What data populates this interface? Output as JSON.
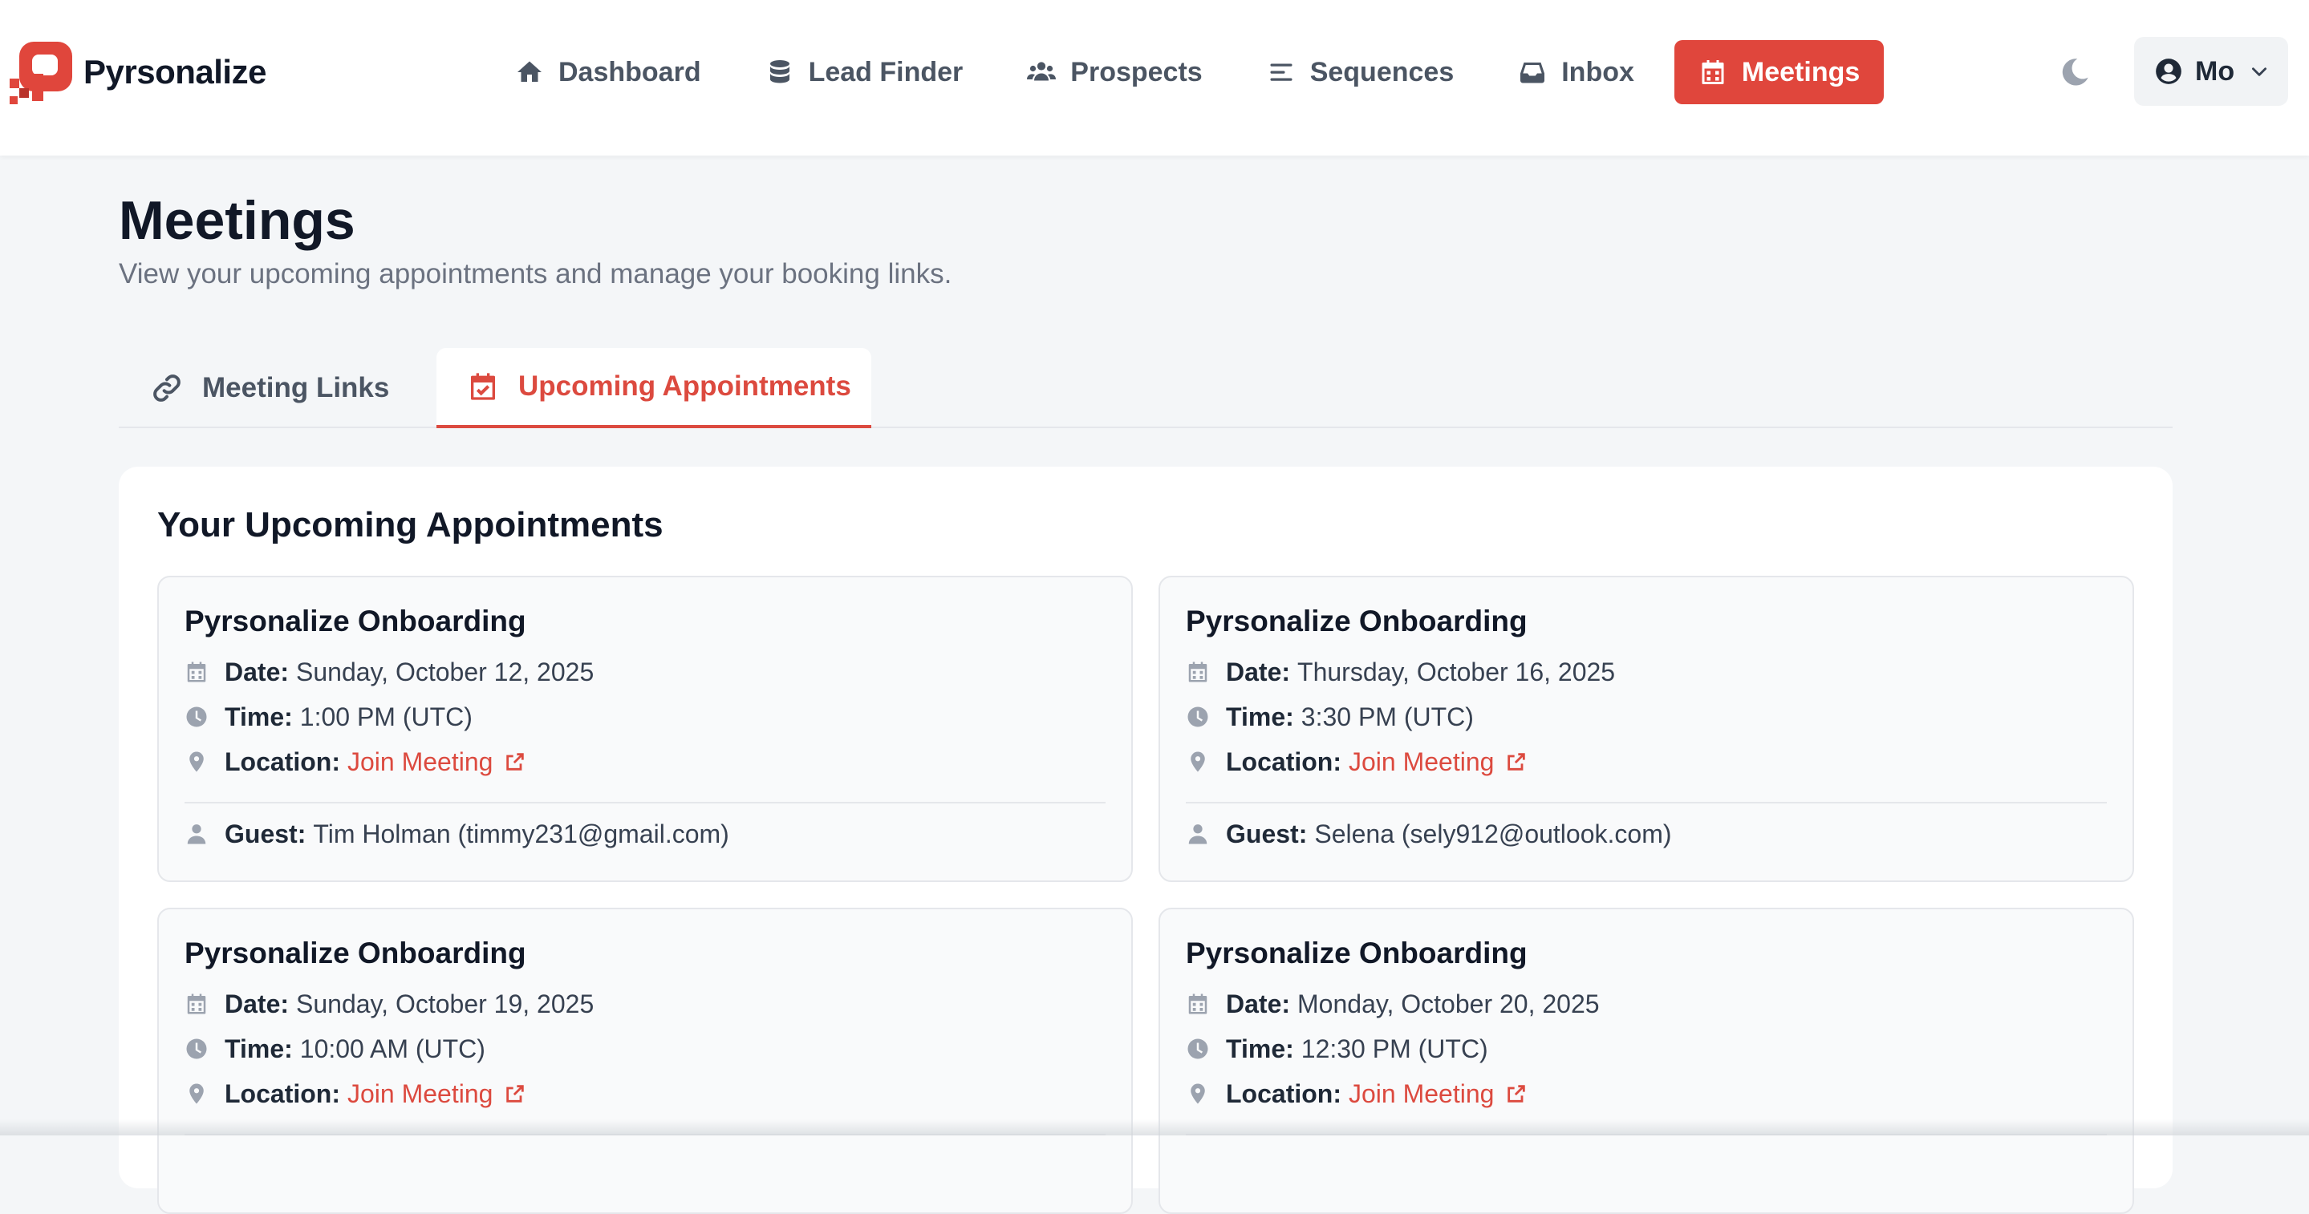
{
  "brand": {
    "name": "Pyrsonalize",
    "accent": "#e0463c"
  },
  "nav": {
    "items": [
      {
        "label": "Dashboard",
        "icon": "home-icon",
        "active": false
      },
      {
        "label": "Lead Finder",
        "icon": "database-icon",
        "active": false
      },
      {
        "label": "Prospects",
        "icon": "users-icon",
        "active": false
      },
      {
        "label": "Sequences",
        "icon": "list-icon",
        "active": false
      },
      {
        "label": "Inbox",
        "icon": "inbox-icon",
        "active": false
      },
      {
        "label": "Meetings",
        "icon": "calendar-icon",
        "active": true
      }
    ]
  },
  "user": {
    "name": "Mo"
  },
  "page": {
    "title": "Meetings",
    "subtitle": "View your upcoming appointments and manage your booking links."
  },
  "tabs": [
    {
      "label": "Meeting Links",
      "icon": "link-icon",
      "active": false
    },
    {
      "label": "Upcoming Appointments",
      "icon": "calendar-check-icon",
      "active": true
    }
  ],
  "panel": {
    "title": "Your Upcoming Appointments"
  },
  "labels": {
    "date": "Date:",
    "time": "Time:",
    "location": "Location:",
    "guest": "Guest:"
  },
  "appointments": [
    {
      "title": "Pyrsonalize Onboarding",
      "date": "Sunday, October 12, 2025",
      "time": "1:00 PM (UTC)",
      "location": "Join Meeting",
      "guest": "Tim Holman (timmy231@gmail.com)"
    },
    {
      "title": "Pyrsonalize Onboarding",
      "date": "Thursday, October 16, 2025",
      "time": "3:30 PM (UTC)",
      "location": "Join Meeting",
      "guest": "Selena (sely912@outlook.com)"
    },
    {
      "title": "Pyrsonalize Onboarding",
      "date": "Sunday, October 19, 2025",
      "time": "10:00 AM (UTC)",
      "location": "Join Meeting"
    },
    {
      "title": "Pyrsonalize Onboarding",
      "date": "Monday, October 20, 2025",
      "time": "12:30 PM (UTC)",
      "location": "Join Meeting"
    }
  ]
}
